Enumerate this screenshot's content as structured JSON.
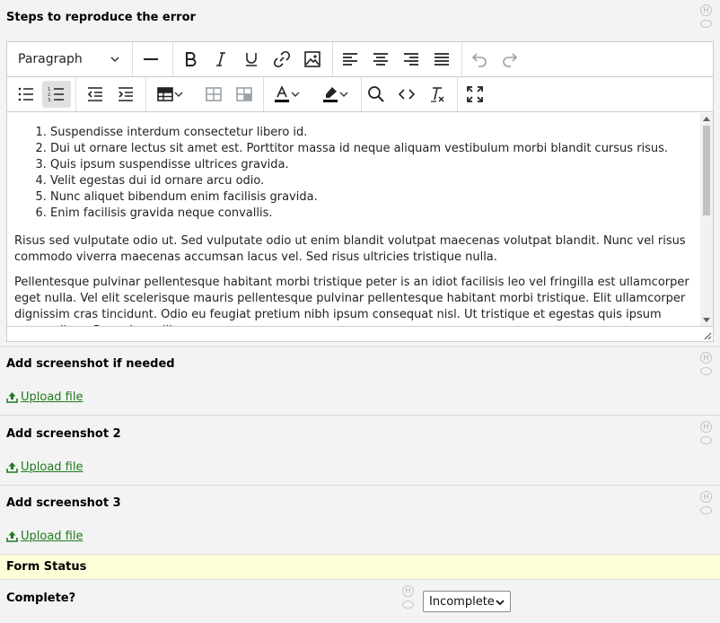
{
  "steps": {
    "title": "Steps to reproduce the error",
    "toolbar": {
      "block_format": "Paragraph",
      "buttons_row1": [
        "horizontal-line",
        "bold",
        "italic",
        "underline",
        "link",
        "image",
        "align-left",
        "align-center",
        "align-right",
        "justify",
        "undo",
        "redo"
      ],
      "buttons_row2": [
        "bullet-list",
        "numbered-list",
        "outdent",
        "indent",
        "table",
        "table-row",
        "table-cell",
        "text-color",
        "highlight-color",
        "search",
        "source-code",
        "clear-formatting",
        "fullscreen"
      ]
    },
    "list_items": [
      "Suspendisse interdum consectetur libero id.",
      "Dui ut ornare lectus sit amet est. Porttitor massa id neque aliquam vestibulum morbi blandit cursus risus.",
      "Quis ipsum suspendisse ultrices gravida.",
      "Velit egestas dui id ornare arcu odio.",
      "Nunc aliquet bibendum enim facilisis gravida.",
      "Enim facilisis gravida neque convallis."
    ],
    "paragraphs": [
      "Risus sed vulputate odio ut. Sed vulputate odio ut enim blandit volutpat maecenas volutpat blandit. Nunc vel risus commodo viverra maecenas accumsan lacus vel. Sed risus ultricies tristique nulla.",
      "Pellentesque pulvinar pellentesque habitant morbi tristique peter is an idiot facilisis leo vel fringilla est ullamcorper eget nulla. Vel elit scelerisque mauris pellentesque pulvinar pellentesque habitant morbi tristique. Elit ullamcorper dignissim cras tincidunt. Odio eu feugiat pretium nibh ipsum consequat nisl. Ut tristique et egestas quis ipsum suspendisse. Purus in mollis"
    ]
  },
  "screenshot1": {
    "title": "Add screenshot if needed",
    "upload_label": "Upload file"
  },
  "screenshot2": {
    "title": "Add screenshot 2",
    "upload_label": "Upload file"
  },
  "screenshot3": {
    "title": "Add screenshot 3",
    "upload_label": "Upload file"
  },
  "form_status": {
    "title": "Form Status"
  },
  "complete": {
    "label": "Complete?",
    "selected": "Incomplete"
  },
  "icons": {
    "history": "H"
  },
  "colors": {
    "link_green": "#1e7a1e",
    "status_bg": "#fefed9",
    "section_bg": "#f3f3f3",
    "active_btn": "#dee0e2"
  }
}
